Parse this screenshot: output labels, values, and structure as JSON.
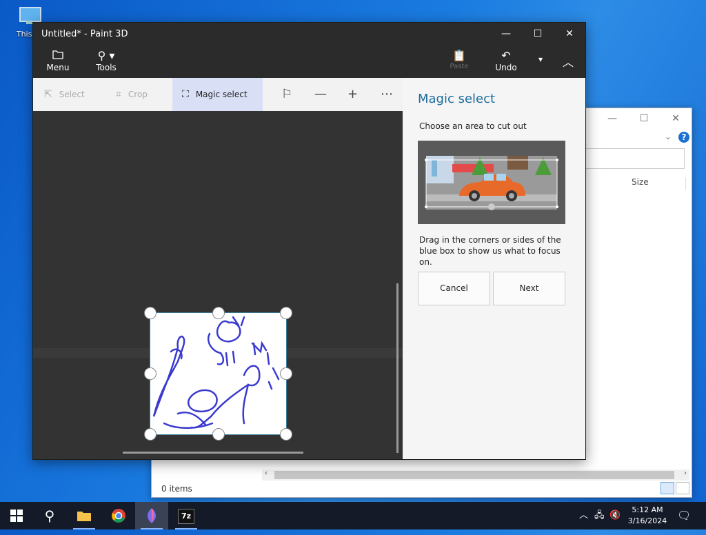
{
  "desktop": {
    "icon_label": "This PC"
  },
  "explorer": {
    "column_size": "Size",
    "status": "0 items",
    "help": "?"
  },
  "paint": {
    "title": "Untitled* - Paint 3D",
    "ribbon": {
      "menu": "Menu",
      "tools": "Tools",
      "paste": "Paste",
      "undo": "Undo"
    },
    "toolbar": {
      "select": "Select",
      "crop": "Crop",
      "magic_select": "Magic select"
    },
    "panel": {
      "title": "Magic select",
      "subtitle": "Choose an area to cut out",
      "hint": "Drag in the corners or sides of the blue box to show us what to focus on.",
      "cancel": "Cancel",
      "next": "Next"
    }
  },
  "taskbar": {
    "time": "5:12 AM",
    "date": "3/16/2024",
    "apps": [
      "start-icon",
      "search-icon",
      "file-explorer-icon",
      "chrome-icon",
      "paint-3d-icon",
      "7zip-icon"
    ]
  },
  "colors": {
    "accent": "#1c6b9c",
    "desktop_blue": "#1a7be0",
    "paint_dark": "#2b2b2b",
    "drawing_ink": "#3a3ad0"
  }
}
